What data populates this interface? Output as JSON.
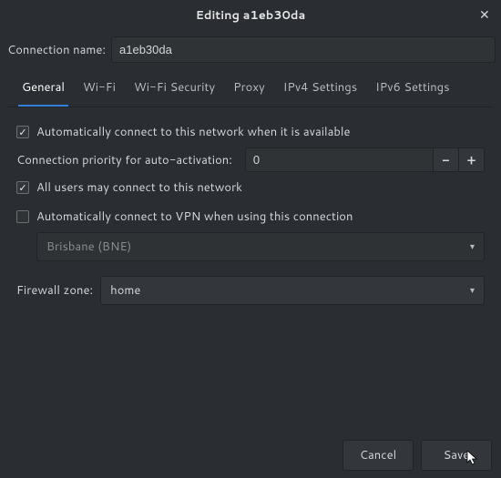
{
  "titlebar": {
    "title": "Editing a1eb30da"
  },
  "connection_name": {
    "label": "Connection name:",
    "value": "a1eb30da"
  },
  "tabs": [
    {
      "label": "General"
    },
    {
      "label": "Wi-Fi"
    },
    {
      "label": "Wi-Fi Security"
    },
    {
      "label": "Proxy"
    },
    {
      "label": "IPv4 Settings"
    },
    {
      "label": "IPv6 Settings"
    }
  ],
  "general": {
    "auto_connect": {
      "checked": true,
      "label": "Automatically connect to this network when it is available"
    },
    "priority": {
      "label": "Connection priority for auto-activation:",
      "value": "0"
    },
    "all_users": {
      "checked": true,
      "label": "All users may connect to this network"
    },
    "auto_vpn": {
      "checked": false,
      "label": "Automatically connect to VPN when using this connection"
    },
    "vpn_select": {
      "value": "Brisbane (BNE)"
    },
    "firewall": {
      "label": "Firewall zone:",
      "value": "home"
    }
  },
  "footer": {
    "cancel": "Cancel",
    "save": "Save"
  }
}
